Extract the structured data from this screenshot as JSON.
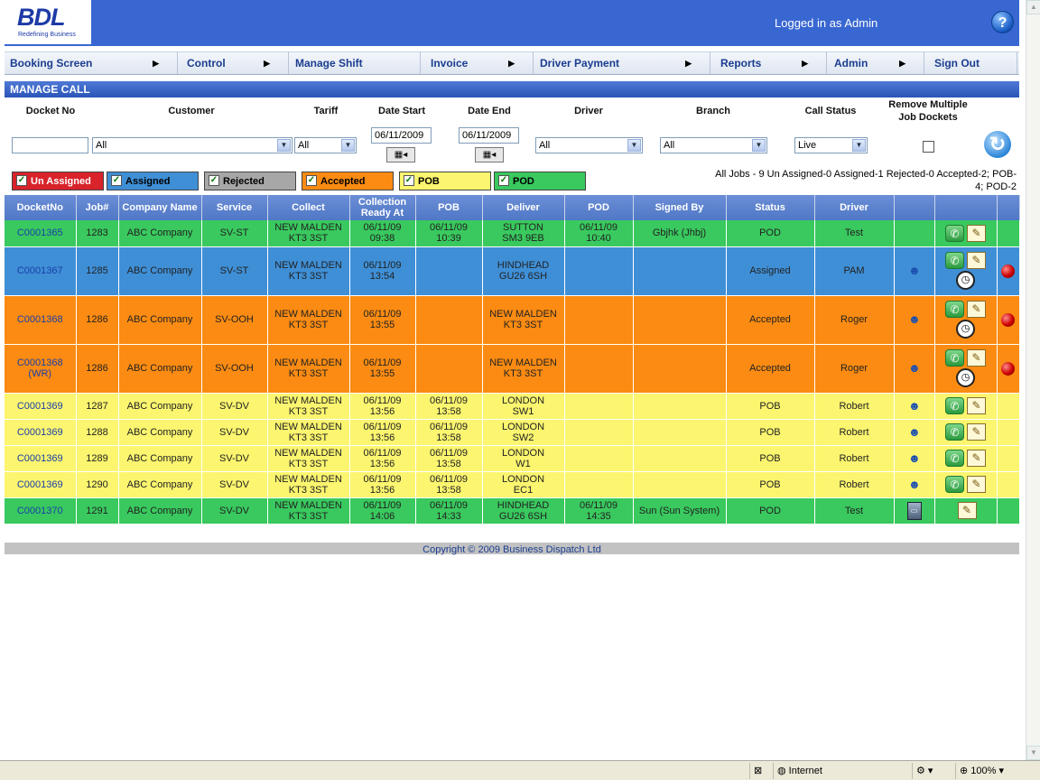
{
  "header": {
    "logo": "BDL",
    "tagline": "Redefining Business",
    "logged_in": "Logged in as Admin",
    "help": "?"
  },
  "nav": [
    "Booking Screen",
    "Control",
    "Manage Shift",
    "Invoice",
    "Driver Payment",
    "Reports",
    "Admin",
    "Sign Out"
  ],
  "section_title": "MANAGE CALL",
  "filters": {
    "labels": {
      "docket": "Docket No",
      "customer": "Customer",
      "tariff": "Tariff",
      "date_start": "Date Start",
      "date_end": "Date End",
      "driver": "Driver",
      "branch": "Branch",
      "call_status": "Call Status",
      "remove_multi_1": "Remove Multiple",
      "remove_multi_2": "Job Dockets"
    },
    "values": {
      "docket": "",
      "customer": "All",
      "tariff": "All",
      "date_start": "06/11/2009",
      "date_end": "06/11/2009",
      "driver": "All",
      "branch": "All",
      "call_status": "Live"
    }
  },
  "legend": [
    {
      "label": "Un Assigned",
      "color": "#d8232a"
    },
    {
      "label": "Assigned",
      "color": "#3f8fd6"
    },
    {
      "label": "Rejected",
      "color": "#a7a7a7"
    },
    {
      "label": "Accepted",
      "color": "#fb8b12"
    },
    {
      "label": "POB",
      "color": "#fbf56f"
    },
    {
      "label": "POD",
      "color": "#39c95e"
    }
  ],
  "summary": {
    "line1": "All Jobs - 9   Un Assigned-0   Assigned-1   Rejected-0   Accepted-2;   POB-",
    "line2": "4;   POD-2"
  },
  "table": {
    "headers": [
      "DocketNo",
      "Job#",
      "Company Name",
      "Service",
      "Collect",
      "Collection Ready At",
      "POB",
      "Deliver",
      "POD",
      "Signed By",
      "Status",
      "Driver",
      "",
      "",
      ""
    ],
    "rows": [
      {
        "cls": "rg",
        "docket": "C0001365",
        "job": "1283",
        "company": "ABC Company",
        "service": "SV-ST",
        "collect1": "NEW MALDEN",
        "collect2": "KT3 3ST",
        "ready1": "06/11/09",
        "ready2": "09:38",
        "pob1": "06/11/09",
        "pob2": "10:39",
        "deliver1": "SUTTON",
        "deliver2": "SM3 9EB",
        "pod1": "06/11/09",
        "pod2": "10:40",
        "signed": "Gbjhk (Jhbj)",
        "status": "POD",
        "driver": "Test",
        "icons": "pn"
      },
      {
        "cls": "rb",
        "docket": "C0001367",
        "job": "1285",
        "company": "ABC Company",
        "service": "SV-ST",
        "collect1": "NEW MALDEN",
        "collect2": "KT3 3ST",
        "ready1": "06/11/09",
        "ready2": "13:54",
        "pob1": "",
        "pob2": "",
        "deliver1": "HINDHEAD",
        "deliver2": "GU26 6SH",
        "pod1": "",
        "pod2": "",
        "signed": "",
        "status": "Assigned",
        "driver": "PAM",
        "icons": "ppncd"
      },
      {
        "cls": "ro",
        "docket": "C0001368",
        "job": "1286",
        "company": "ABC Company",
        "service": "SV-OOH",
        "collect1": "NEW MALDEN",
        "collect2": "KT3 3ST",
        "ready1": "06/11/09",
        "ready2": "13:55",
        "pob1": "",
        "pob2": "",
        "deliver1": "NEW MALDEN",
        "deliver2": "KT3 3ST",
        "pod1": "",
        "pod2": "",
        "signed": "",
        "status": "Accepted",
        "driver": "Roger",
        "icons": "ppncd"
      },
      {
        "cls": "ro",
        "docket": "C0001368 (WR)",
        "job": "1286",
        "company": "ABC Company",
        "service": "SV-OOH",
        "collect1": "NEW MALDEN",
        "collect2": "KT3 3ST",
        "ready1": "06/11/09",
        "ready2": "13:55",
        "pob1": "",
        "pob2": "",
        "deliver1": "NEW MALDEN",
        "deliver2": "KT3 3ST",
        "pod1": "",
        "pod2": "",
        "signed": "",
        "status": "Accepted",
        "driver": "Roger",
        "icons": "ppncd"
      },
      {
        "cls": "ry",
        "docket": "C0001369",
        "job": "1287",
        "company": "ABC Company",
        "service": "SV-DV",
        "collect1": "NEW MALDEN",
        "collect2": "KT3 3ST",
        "ready1": "06/11/09",
        "ready2": "13:56",
        "pob1": "06/11/09",
        "pob2": "13:58",
        "deliver1": "LONDON",
        "deliver2": "SW1",
        "pod1": "",
        "pod2": "",
        "signed": "",
        "status": "POB",
        "driver": "Robert",
        "icons": "ppn"
      },
      {
        "cls": "ry",
        "docket": "C0001369",
        "job": "1288",
        "company": "ABC Company",
        "service": "SV-DV",
        "collect1": "NEW MALDEN",
        "collect2": "KT3 3ST",
        "ready1": "06/11/09",
        "ready2": "13:56",
        "pob1": "06/11/09",
        "pob2": "13:58",
        "deliver1": "LONDON",
        "deliver2": "SW2",
        "pod1": "",
        "pod2": "",
        "signed": "",
        "status": "POB",
        "driver": "Robert",
        "icons": "ppn"
      },
      {
        "cls": "ry",
        "docket": "C0001369",
        "job": "1289",
        "company": "ABC Company",
        "service": "SV-DV",
        "collect1": "NEW MALDEN",
        "collect2": "KT3 3ST",
        "ready1": "06/11/09",
        "ready2": "13:56",
        "pob1": "06/11/09",
        "pob2": "13:58",
        "deliver1": "LONDON",
        "deliver2": "W1",
        "pod1": "",
        "pod2": "",
        "signed": "",
        "status": "POB",
        "driver": "Robert",
        "icons": "ppn"
      },
      {
        "cls": "ry",
        "docket": "C0001369",
        "job": "1290",
        "company": "ABC Company",
        "service": "SV-DV",
        "collect1": "NEW MALDEN",
        "collect2": "KT3 3ST",
        "ready1": "06/11/09",
        "ready2": "13:56",
        "pob1": "06/11/09",
        "pob2": "13:58",
        "deliver1": "LONDON",
        "deliver2": "EC1",
        "pod1": "",
        "pod2": "",
        "signed": "",
        "status": "POB",
        "driver": "Robert",
        "icons": "ppn"
      },
      {
        "cls": "rg",
        "docket": "C0001370",
        "job": "1291",
        "company": "ABC Company",
        "service": "SV-DV",
        "collect1": "NEW MALDEN",
        "collect2": "KT3 3ST",
        "ready1": "06/11/09",
        "ready2": "14:06",
        "pob1": "06/11/09",
        "pob2": "14:33",
        "deliver1": "HINDHEAD",
        "deliver2": "GU26 6SH",
        "pod1": "06/11/09",
        "pod2": "14:35",
        "signed": "Sun (Sun System)",
        "status": "POD",
        "driver": "Test",
        "icons": "mn"
      }
    ]
  },
  "footer": {
    "copyright": "Copyright © 2009 Business Dispatch Ltd"
  },
  "statusbar": {
    "zone": "Internet",
    "zoom": "100%"
  }
}
